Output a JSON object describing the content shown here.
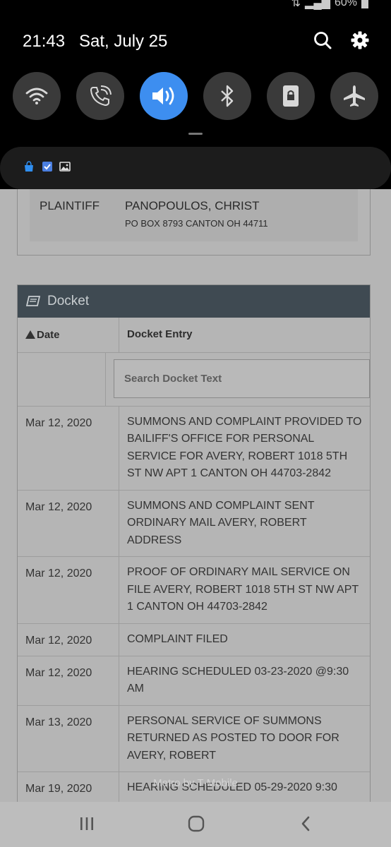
{
  "status_bar": {
    "battery": "60%"
  },
  "header": {
    "time": "21:43",
    "date": "Sat, July 25"
  },
  "quick_settings": [
    {
      "icon": "wifi-icon",
      "active": false
    },
    {
      "icon": "wifi-calling-icon",
      "active": false
    },
    {
      "icon": "sound-icon",
      "active": true
    },
    {
      "icon": "bluetooth-icon",
      "active": false
    },
    {
      "icon": "portrait-lock-icon",
      "active": false
    },
    {
      "icon": "airplane-mode-icon",
      "active": false
    }
  ],
  "notification_icons": [
    "bag-icon",
    "checkbox-icon",
    "image-icon"
  ],
  "party": {
    "role": "PLAINTIFF",
    "name": "PANOPOULOS, CHRIST",
    "address": "PO BOX 8793 CANTON OH 44711"
  },
  "docket": {
    "title": "Docket",
    "col_date": "Date",
    "col_entry": "Docket Entry",
    "search_placeholder": "Search Docket Text",
    "entries": [
      {
        "date": "Mar 12, 2020",
        "text": "SUMMONS AND COMPLAINT PROVIDED TO BAILIFF'S OFFICE FOR PERSONAL SERVICE FOR AVERY, ROBERT 1018 5TH ST NW APT 1 CANTON OH 44703-2842"
      },
      {
        "date": "Mar 12, 2020",
        "text": "SUMMONS AND COMPLAINT SENT ORDINARY MAIL AVERY, ROBERT ADDRESS"
      },
      {
        "date": "Mar 12, 2020",
        "text": "PROOF OF ORDINARY MAIL SERVICE ON FILE AVERY, ROBERT 1018 5TH ST NW APT 1 CANTON OH 44703-2842"
      },
      {
        "date": "Mar 12, 2020",
        "text": "COMPLAINT FILED"
      },
      {
        "date": "Mar 12, 2020",
        "text": "HEARING SCHEDULED 03-23-2020 @9:30 AM"
      },
      {
        "date": "Mar 13, 2020",
        "text": "PERSONAL SERVICE OF SUMMONS RETURNED AS POSTED TO DOOR FOR AVERY, ROBERT"
      },
      {
        "date": "Mar 19, 2020",
        "text": "HEARING SCHEDULED 05-29-2020 9:30"
      }
    ]
  },
  "carrier_watermark": "Metro by T-Mobile",
  "colors": {
    "accent": "#3d8ef0",
    "docket_header": "#3f4a52"
  }
}
